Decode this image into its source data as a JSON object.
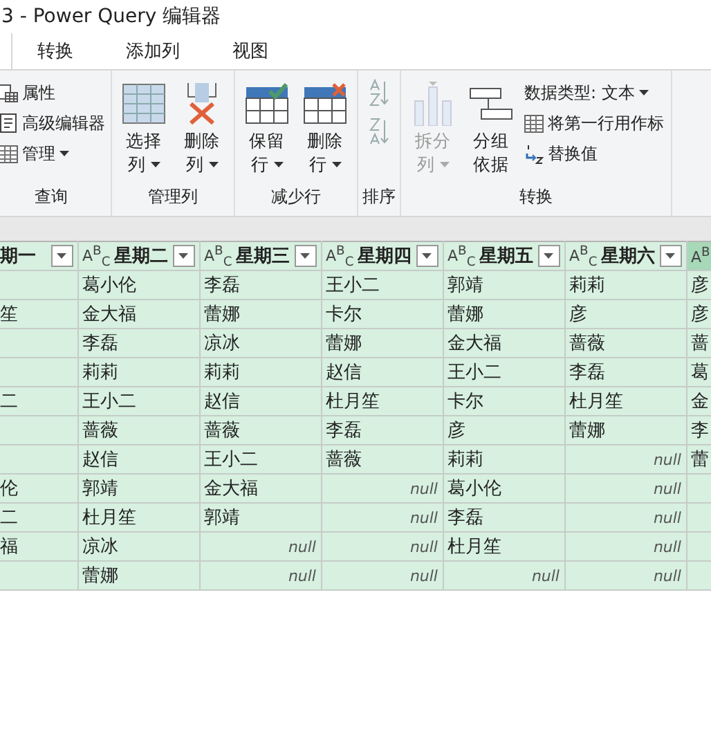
{
  "window": {
    "title": "3 - Power Query 编辑器"
  },
  "tabs": [
    {
      "label": "转换",
      "selected": false
    },
    {
      "label": "添加列",
      "selected": false
    },
    {
      "label": "视图",
      "selected": false
    }
  ],
  "ribbon": [
    {
      "label": "查询",
      "items": [
        {
          "kind": "small",
          "label": "属性",
          "dropdown": false,
          "disabled": false
        },
        {
          "kind": "small",
          "label": "高级编辑器",
          "dropdown": false,
          "disabled": false
        },
        {
          "kind": "small",
          "label": "管理",
          "dropdown": true,
          "disabled": false
        }
      ]
    },
    {
      "label": "管理列",
      "items": [
        {
          "kind": "large",
          "label": "选择",
          "label2": "列",
          "dropdown": true,
          "disabled": false
        },
        {
          "kind": "large",
          "label": "删除",
          "label2": "列",
          "dropdown": true,
          "disabled": false
        }
      ]
    },
    {
      "label": "减少行",
      "items": [
        {
          "kind": "large",
          "label": "保留",
          "label2": "行",
          "dropdown": true,
          "disabled": false
        },
        {
          "kind": "large",
          "label": "删除",
          "label2": "行",
          "dropdown": true,
          "disabled": false
        }
      ]
    },
    {
      "label": "排序",
      "items": [
        {
          "kind": "sort",
          "disabled": true
        },
        {
          "kind": "sort",
          "disabled": true
        }
      ]
    },
    {
      "label": "转换",
      "items": [
        {
          "kind": "large",
          "label": "拆分",
          "label2": "列",
          "dropdown": true,
          "disabled": true
        },
        {
          "kind": "large",
          "label": "分组",
          "label2": "依据",
          "dropdown": false,
          "disabled": false
        },
        {
          "kind": "stack",
          "items": [
            {
              "label": "数据类型: 文本",
              "dropdown": true
            },
            {
              "label": "将第一行用作标",
              "dropdown": false
            },
            {
              "label": "替换值",
              "dropdown": false
            }
          ]
        }
      ]
    }
  ],
  "table": {
    "columns": [
      {
        "name": "期一",
        "selected": false
      },
      {
        "name": "星期二",
        "type_label": "A$^{B}$$_{C}$",
        "selected": false
      },
      {
        "name": "星期三",
        "type_label": "A$^{B}$$_{C}$",
        "selected": false
      },
      {
        "name": "星期四",
        "type_label": "A$^{B}$$_{C}$",
        "selected": false
      },
      {
        "name": "星期五",
        "type_label": "A$^{B}$$_{C}$",
        "selected": false
      },
      {
        "name": "星期六",
        "type_label": "A$^{B}$$_{C}$",
        "selected": false
      },
      {
        "type_label": "A$^{B}$",
        "selected": true
      }
    ],
    "rows": [
      [
        "",
        "葛小伦",
        "李磊",
        "王小二",
        "郭靖",
        "莉莉",
        "彦"
      ],
      [
        "笙",
        "金大福",
        "蕾娜",
        "卡尔",
        "蕾娜",
        "彦",
        "彦"
      ],
      [
        "",
        "李磊",
        "凉冰",
        "蕾娜",
        "金大福",
        "蔷薇",
        "蔷"
      ],
      [
        "",
        "莉莉",
        "莉莉",
        "赵信",
        "王小二",
        "李磊",
        "葛"
      ],
      [
        "二",
        "王小二",
        "赵信",
        "杜月笙",
        "卡尔",
        "杜月笙",
        "金"
      ],
      [
        "",
        "蔷薇",
        "蔷薇",
        "李磊",
        "彦",
        "蕾娜",
        "李"
      ],
      [
        "",
        "赵信",
        "王小二",
        "蔷薇",
        "莉莉",
        {
          "kind": "null",
          "text": "null"
        },
        "蕾"
      ],
      [
        "伦",
        "郭靖",
        "金大福",
        {
          "kind": "null",
          "text": "null"
        },
        "葛小伦",
        {
          "kind": "null",
          "text": "null"
        },
        ""
      ],
      [
        "二",
        "杜月笙",
        "郭靖",
        {
          "kind": "null",
          "text": "null"
        },
        "李磊",
        {
          "kind": "null",
          "text": "null"
        },
        ""
      ],
      [
        "福",
        "凉冰",
        {
          "kind": "null",
          "text": "null"
        },
        {
          "kind": "null",
          "text": "null"
        },
        "杜月笙",
        {
          "kind": "null",
          "text": "null"
        },
        ""
      ],
      [
        "",
        "蕾娜",
        {
          "kind": "null",
          "text": "null"
        },
        {
          "kind": "null",
          "text": "null"
        },
        {
          "kind": "null",
          "text": "null"
        },
        {
          "kind": "null",
          "text": "null"
        },
        ""
      ]
    ]
  }
}
